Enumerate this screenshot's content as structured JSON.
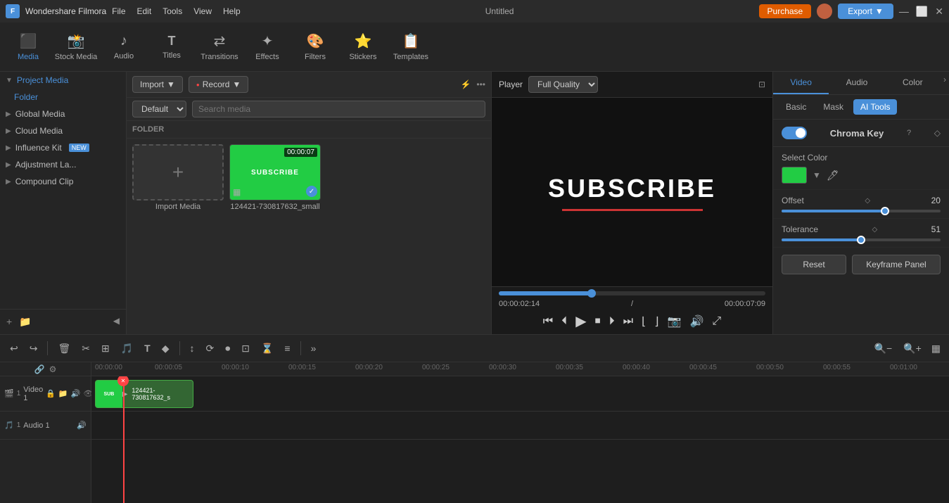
{
  "titlebar": {
    "app_name": "Wondershare Filmora",
    "menu_items": [
      "File",
      "Edit",
      "Tools",
      "View",
      "Help"
    ],
    "title": "Untitled",
    "purchase_label": "Purchase",
    "export_label": "Export"
  },
  "toolbar": {
    "items": [
      {
        "id": "media",
        "icon": "🎬",
        "label": "Media"
      },
      {
        "id": "stock",
        "icon": "📸",
        "label": "Stock Media"
      },
      {
        "id": "audio",
        "icon": "🎵",
        "label": "Audio"
      },
      {
        "id": "titles",
        "icon": "T",
        "label": "Titles"
      },
      {
        "id": "transitions",
        "icon": "↔",
        "label": "Transitions"
      },
      {
        "id": "effects",
        "icon": "✨",
        "label": "Effects"
      },
      {
        "id": "filters",
        "icon": "🎨",
        "label": "Filters"
      },
      {
        "id": "stickers",
        "icon": "⭐",
        "label": "Stickers"
      },
      {
        "id": "templates",
        "icon": "📋",
        "label": "Templates"
      }
    ]
  },
  "left_panel": {
    "sections": [
      {
        "id": "project-media",
        "label": "Project Media",
        "expanded": true
      },
      {
        "id": "folder",
        "label": "Folder",
        "indent": true
      },
      {
        "id": "global-media",
        "label": "Global Media",
        "expanded": false
      },
      {
        "id": "cloud-media",
        "label": "Cloud Media",
        "expanded": false
      },
      {
        "id": "influence-kit",
        "label": "Influence Kit",
        "expanded": false,
        "badge": "NEW"
      },
      {
        "id": "adjustment-la",
        "label": "Adjustment La...",
        "expanded": false
      },
      {
        "id": "compound-clip",
        "label": "Compound Clip",
        "expanded": false
      }
    ],
    "add_btn": "+",
    "folder_btn": "📁"
  },
  "media_panel": {
    "import_label": "Import",
    "record_label": "Record",
    "default_label": "Default",
    "search_placeholder": "Search media",
    "folder_label": "FOLDER",
    "items": [
      {
        "id": "import",
        "name": "Import Media",
        "type": "import"
      },
      {
        "id": "clip1",
        "name": "124421-730817632_small",
        "type": "video",
        "duration": "00:00:07",
        "selected": true
      }
    ]
  },
  "preview": {
    "player_label": "Player",
    "quality_label": "Full Quality",
    "preview_text": "SUBSCRIBE",
    "current_time": "00:00:02:14",
    "total_time": "00:00:07:09",
    "progress_pct": 35
  },
  "right_panel": {
    "tabs": [
      "Video",
      "Audio",
      "Color"
    ],
    "active_tab": "Video",
    "subtabs": [
      "Basic",
      "Mask",
      "AI Tools"
    ],
    "active_subtab": "AI Tools",
    "chroma_key": {
      "label": "Chroma Key",
      "enabled": true
    },
    "color_label": "Select Color",
    "offset_label": "Offset",
    "offset_value": "20",
    "offset_pct": 65,
    "tolerance_label": "Tolerance",
    "tolerance_value": "51",
    "tolerance_pct": 50,
    "reset_label": "Reset",
    "keyframe_label": "Keyframe Panel"
  },
  "bottom_toolbar": {
    "buttons": [
      "↩",
      "↪",
      "🗑",
      "✂",
      "⊞",
      "🎵",
      "T",
      "◆",
      "↕",
      "⟳",
      "⏺",
      "⊡",
      "⌛",
      "≡"
    ],
    "zoom_minus": "−",
    "zoom_plus": "+",
    "grid_icon": "▦"
  },
  "timeline": {
    "ruler_marks": [
      "00:00:00",
      "00:00:05",
      "00:00:10",
      "00:00:15",
      "00:00:20",
      "00:00:25",
      "00:00:30",
      "00:00:35",
      "00:00:40",
      "00:00:45",
      "00:00:50",
      "00:00:55",
      "00:01:00"
    ],
    "tracks": [
      {
        "id": "video1",
        "label": "Video 1",
        "type": "video"
      },
      {
        "id": "audio1",
        "label": "Audio 1",
        "type": "audio"
      }
    ],
    "clip": {
      "name": "124421-730817632_s"
    }
  }
}
